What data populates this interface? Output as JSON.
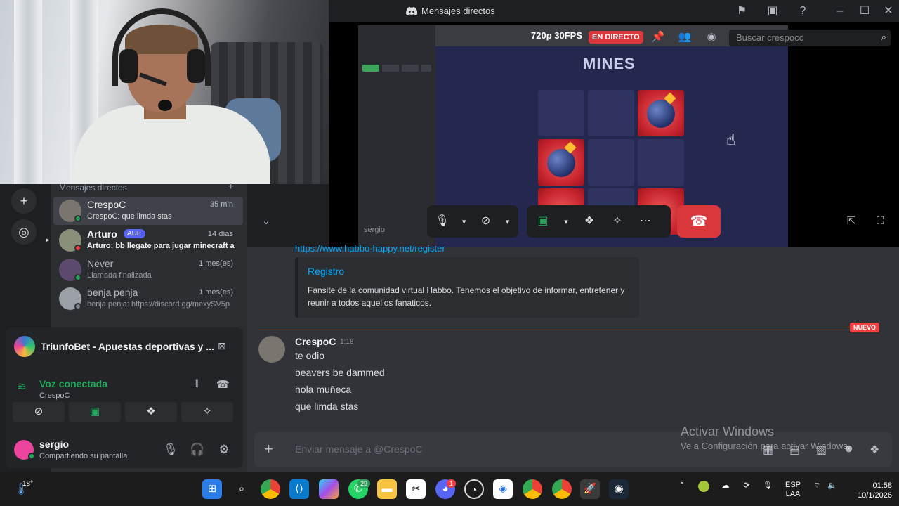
{
  "window": {
    "title": "Mensajes directos"
  },
  "stream": {
    "quality": "720p 30FPS",
    "live_label": "EN DIRECTO",
    "search_placeholder": "Buscar crespocc",
    "game_title": "MINES",
    "overlay_name": "sergio"
  },
  "dm_panel": {
    "header": "Mensajes directos",
    "items": [
      {
        "name": "CrespoC",
        "sub": "CrespoC: que limda stas",
        "time": "35 min",
        "status_color": "#23a55a"
      },
      {
        "name": "Arturo",
        "badge": "AUE",
        "sub": "Arturo: bb llegate para jugar minecraft a...",
        "time": "14 días",
        "status_color": "#f23f43"
      },
      {
        "name": "Never",
        "sub": "Llamada finalizada",
        "time": "1 mes(es)",
        "status_color": "#23a55a"
      },
      {
        "name": "benja penja",
        "sub": "benja penja: https://discord.gg/mexySV5p",
        "time": "1 mes(es)",
        "status_color": "#80848e"
      }
    ]
  },
  "server_card": {
    "title": "TriunfoBet - Apuestas deportivas y ...",
    "voice_title": "Voz conectada",
    "voice_sub": "CrespoC",
    "user_name": "sergio",
    "user_sub": "Compartiendo su pantalla"
  },
  "chat": {
    "link": "https://www.habbo-happy.net/register",
    "embed_title": "Registro",
    "embed_desc": "Fansite de la comunidad virtual Habbo. Tenemos el objetivo de informar, entretener y reunir a todos aquellos fanaticos.",
    "new_label": "NUEVO",
    "author": "CrespoC",
    "time": "1:18",
    "messages": [
      "te odio",
      "beavers be dammed",
      "hola muñeca",
      "que limda stas"
    ],
    "composer_placeholder": "Enviar mensaje a @CrespoC"
  },
  "watermark": {
    "line1": "Activar Windows",
    "line2": "Ve a Configuración para activar Windows."
  },
  "taskbar": {
    "weather": "18°",
    "whatsapp_badge": "29",
    "discord_badge": "1",
    "lang_1": "ESP",
    "lang_2": "LAA",
    "time": "01:58",
    "date": "10/1/2026"
  },
  "colors": {
    "accent_red": "#da373c",
    "online_green": "#23a55a",
    "link_blue": "#00a8fc"
  }
}
